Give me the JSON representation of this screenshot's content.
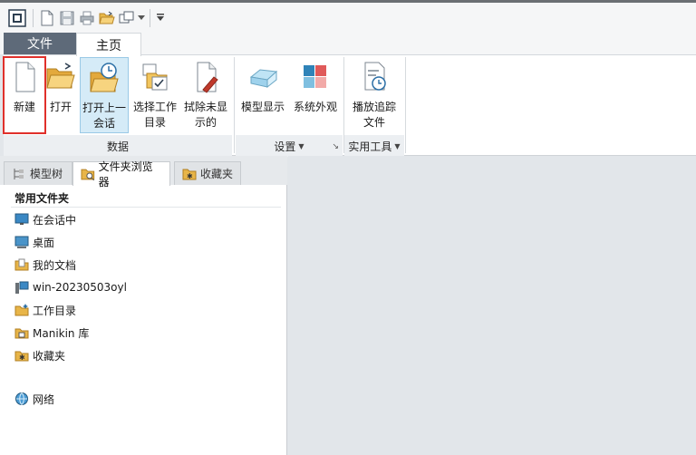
{
  "qat": {
    "items": [
      "app-icon",
      "new-icon",
      "save-icon",
      "print-icon",
      "open-icon",
      "windows-icon",
      "dropdown-icon",
      "customize-icon"
    ]
  },
  "tabs": {
    "file": "文件",
    "home": "主页"
  },
  "ribbon": {
    "buttons": {
      "new": "新建",
      "open": "打开",
      "open_last_1": "打开上一",
      "open_last_2": "会话",
      "select_dir_1": "选择工作",
      "select_dir_2": "目录",
      "erase_1": "拭除未显",
      "erase_2": "示的",
      "model_display": "模型显示",
      "system_appearance": "系统外观",
      "playback_1": "播放追踪",
      "playback_2": "文件"
    },
    "groups": {
      "data": "数据",
      "settings": "设置",
      "utilities": "实用工具"
    }
  },
  "panel": {
    "tabs": {
      "model_tree": "模型树",
      "folder_browser": "文件夹浏览器",
      "favorites": "收藏夹"
    },
    "section_title": "常用文件夹",
    "folders": {
      "in_session": "在会话中",
      "desktop": "桌面",
      "my_documents": "我的文档",
      "computer": "win-20230503oyl",
      "working_dir": "工作目录",
      "manikin": "Manikin 库",
      "favorites": "收藏夹",
      "network": "网络"
    }
  },
  "colors": {
    "file_tab": "#5e6a79",
    "active_button": "#d5ebf7",
    "highlight": "#e0302b"
  }
}
